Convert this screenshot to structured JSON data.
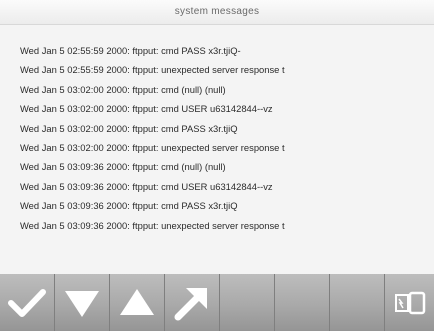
{
  "window": {
    "title": "system messages"
  },
  "log": {
    "lines": [
      "Wed Jan  5 02:55:59 2000: ftpput: cmd PASS x3r.tjiQ-",
      "Wed Jan  5 02:55:59 2000: ftpput: unexpected server response t",
      "Wed Jan  5 03:02:00 2000: ftpput: cmd (null) (null)",
      "Wed Jan  5 03:02:00 2000: ftpput: cmd USER u63142844--vz",
      "Wed Jan  5 03:02:00 2000: ftpput: cmd PASS x3r.tjiQ",
      "Wed Jan  5 03:02:00 2000: ftpput: unexpected server response t",
      "Wed Jan  5 03:09:36 2000: ftpput: cmd (null) (null)",
      "Wed Jan  5 03:09:36 2000: ftpput: cmd USER u63142844--vz",
      "Wed Jan  5 03:09:36 2000: ftpput: cmd PASS x3r.tjiQ",
      "Wed Jan  5 03:09:36 2000: ftpput: unexpected server response t"
    ]
  },
  "toolbar": {
    "buttons": [
      {
        "icon": "checkmark-icon"
      },
      {
        "icon": "arrow-down-icon"
      },
      {
        "icon": "arrow-up-icon"
      },
      {
        "icon": "arrow-diagonal-icon"
      },
      {
        "icon": ""
      },
      {
        "icon": ""
      },
      {
        "icon": ""
      },
      {
        "icon": "screen-switch-icon"
      }
    ]
  },
  "colors": {
    "icon": "#ffffff",
    "toolbar": "#a9a9a9",
    "background": "#f4f4f4"
  }
}
